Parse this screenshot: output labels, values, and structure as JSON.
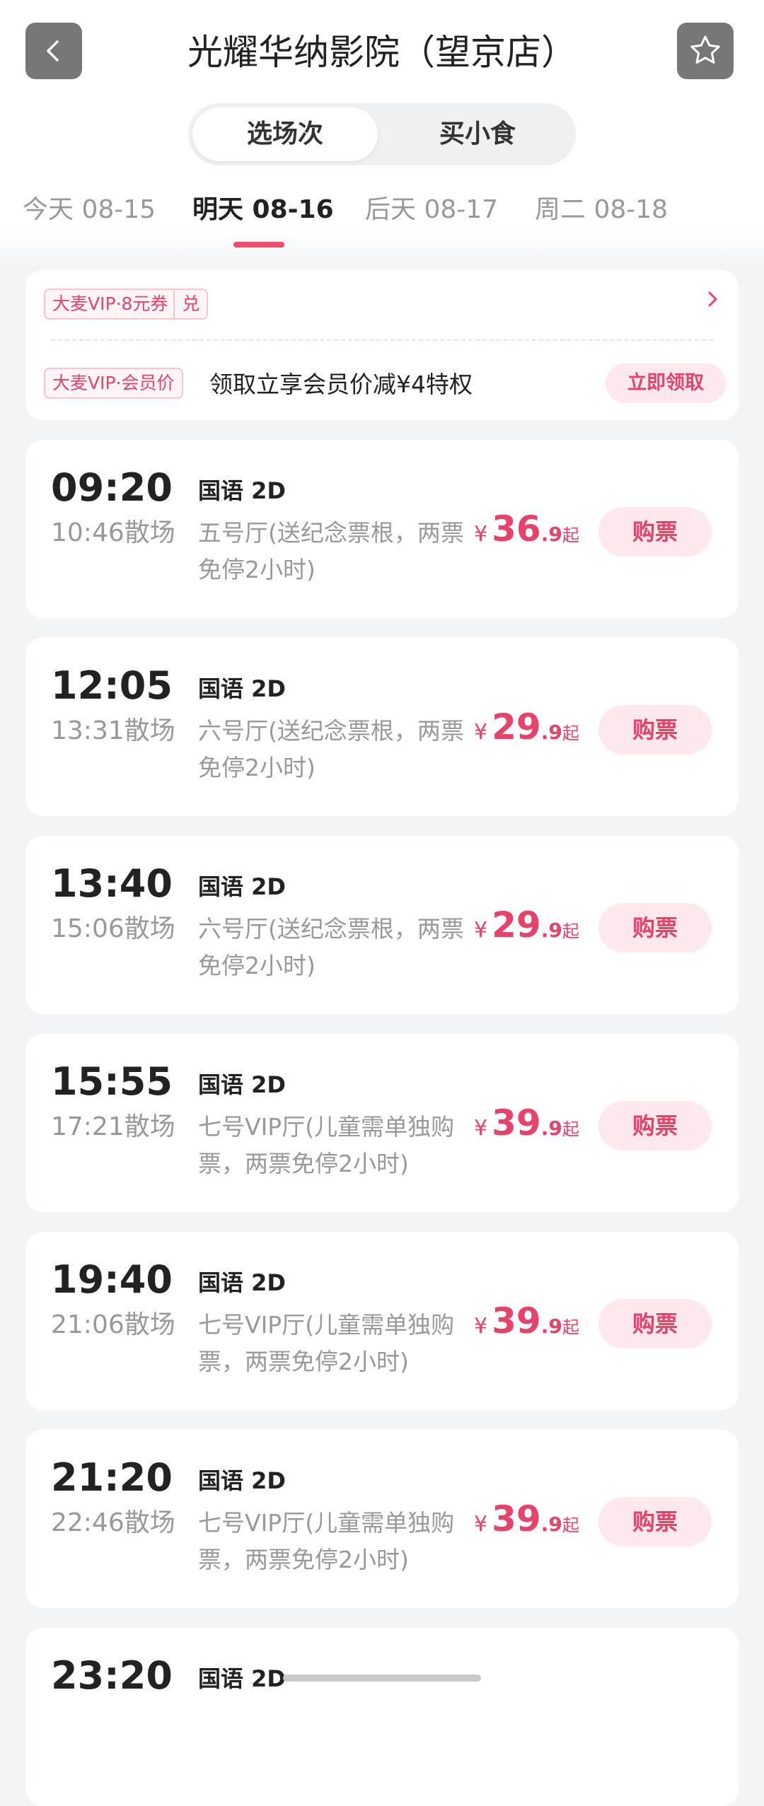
{
  "header": {
    "title": "光耀华纳影院（望京店）",
    "back_icon": "chevron-left-icon",
    "favorite_icon": "star-outline-icon"
  },
  "segments": [
    "选场次",
    "买小食"
  ],
  "dates": [
    "今天 08-15",
    "明天 08-16",
    "后天 08-17",
    "周二 08-18"
  ],
  "selected_date_index": 1,
  "promo": {
    "coupon_brand": "大麦VIP",
    "coupon_sep": "·",
    "coupon_text": "8元券",
    "coupon_redeem": "兑",
    "member_brand": "大麦VIP",
    "member_sep": "·",
    "member_text": "会员价",
    "member_desc": "领取立享会员价减¥4特权",
    "claim_label": "立即领取"
  },
  "showtimes": [
    {
      "start": "09:20",
      "end": "10:46散场",
      "lang": "国语 2D",
      "hall": "五号厅(送纪念票根，两票免停2小时)",
      "yen": "¥",
      "price_int": "36",
      "price_dec": ".9",
      "price_suffix": "起",
      "buy": "购票"
    },
    {
      "start": "12:05",
      "end": "13:31散场",
      "lang": "国语 2D",
      "hall": "六号厅(送纪念票根，两票免停2小时)",
      "yen": "¥",
      "price_int": "29",
      "price_dec": ".9",
      "price_suffix": "起",
      "buy": "购票"
    },
    {
      "start": "13:40",
      "end": "15:06散场",
      "lang": "国语 2D",
      "hall": "六号厅(送纪念票根，两票免停2小时)",
      "yen": "¥",
      "price_int": "29",
      "price_dec": ".9",
      "price_suffix": "起",
      "buy": "购票"
    },
    {
      "start": "15:55",
      "end": "17:21散场",
      "lang": "国语 2D",
      "hall": "七号VIP厅(儿童需单独购票，两票免停2小时)",
      "yen": "¥",
      "price_int": "39",
      "price_dec": ".9",
      "price_suffix": "起",
      "buy": "购票"
    },
    {
      "start": "19:40",
      "end": "21:06散场",
      "lang": "国语 2D",
      "hall": "七号VIP厅(儿童需单独购票，两票免停2小时)",
      "yen": "¥",
      "price_int": "39",
      "price_dec": ".9",
      "price_suffix": "起",
      "buy": "购票"
    },
    {
      "start": "21:20",
      "end": "22:46散场",
      "lang": "国语 2D",
      "hall": "七号VIP厅(儿童需单独购票，两票免停2小时)",
      "yen": "¥",
      "price_int": "39",
      "price_dec": ".9",
      "price_suffix": "起",
      "buy": "购票"
    },
    {
      "start": "23:20",
      "end": "",
      "lang": "国语 2D",
      "hall": "",
      "yen": "",
      "price_int": "",
      "price_dec": "",
      "price_suffix": "",
      "buy": ""
    }
  ],
  "colors": {
    "accent": "#e8416a",
    "accent_light": "#fde8ee",
    "background": "#f3f4f6",
    "icon_button": "#777777"
  }
}
